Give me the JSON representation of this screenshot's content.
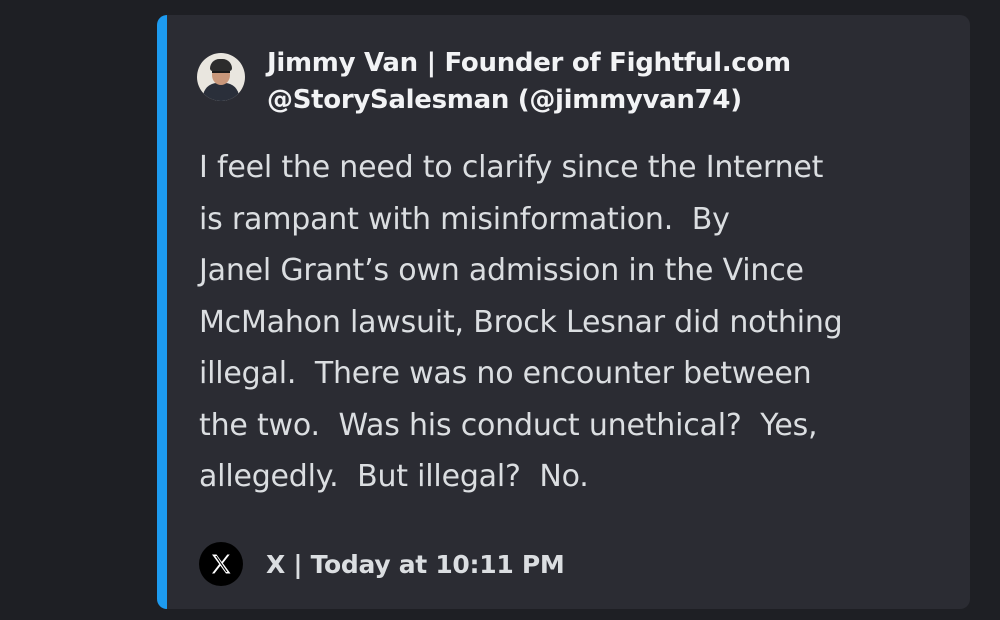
{
  "embed": {
    "accent_color": "#1d9bf0",
    "author": {
      "name": "Jimmy Van | Founder of Fightful.com",
      "handle": "@StorySalesman (@jimmyvan74)",
      "avatar_icon": "profile-photo"
    },
    "text": "I feel the need to clarify since the Internet\nis rampant with misinformation.  By\nJanel Grant’s own admission in the Vince\nMcMahon lawsuit, Brock Lesnar did nothing\nillegal.  There was no encounter between\nthe two.  Was his conduct unethical?  Yes,\nallegedly.  But illegal?  No.",
    "footer": {
      "icon": "x-logo-icon",
      "text": "X | Today at 10:11 PM"
    }
  }
}
